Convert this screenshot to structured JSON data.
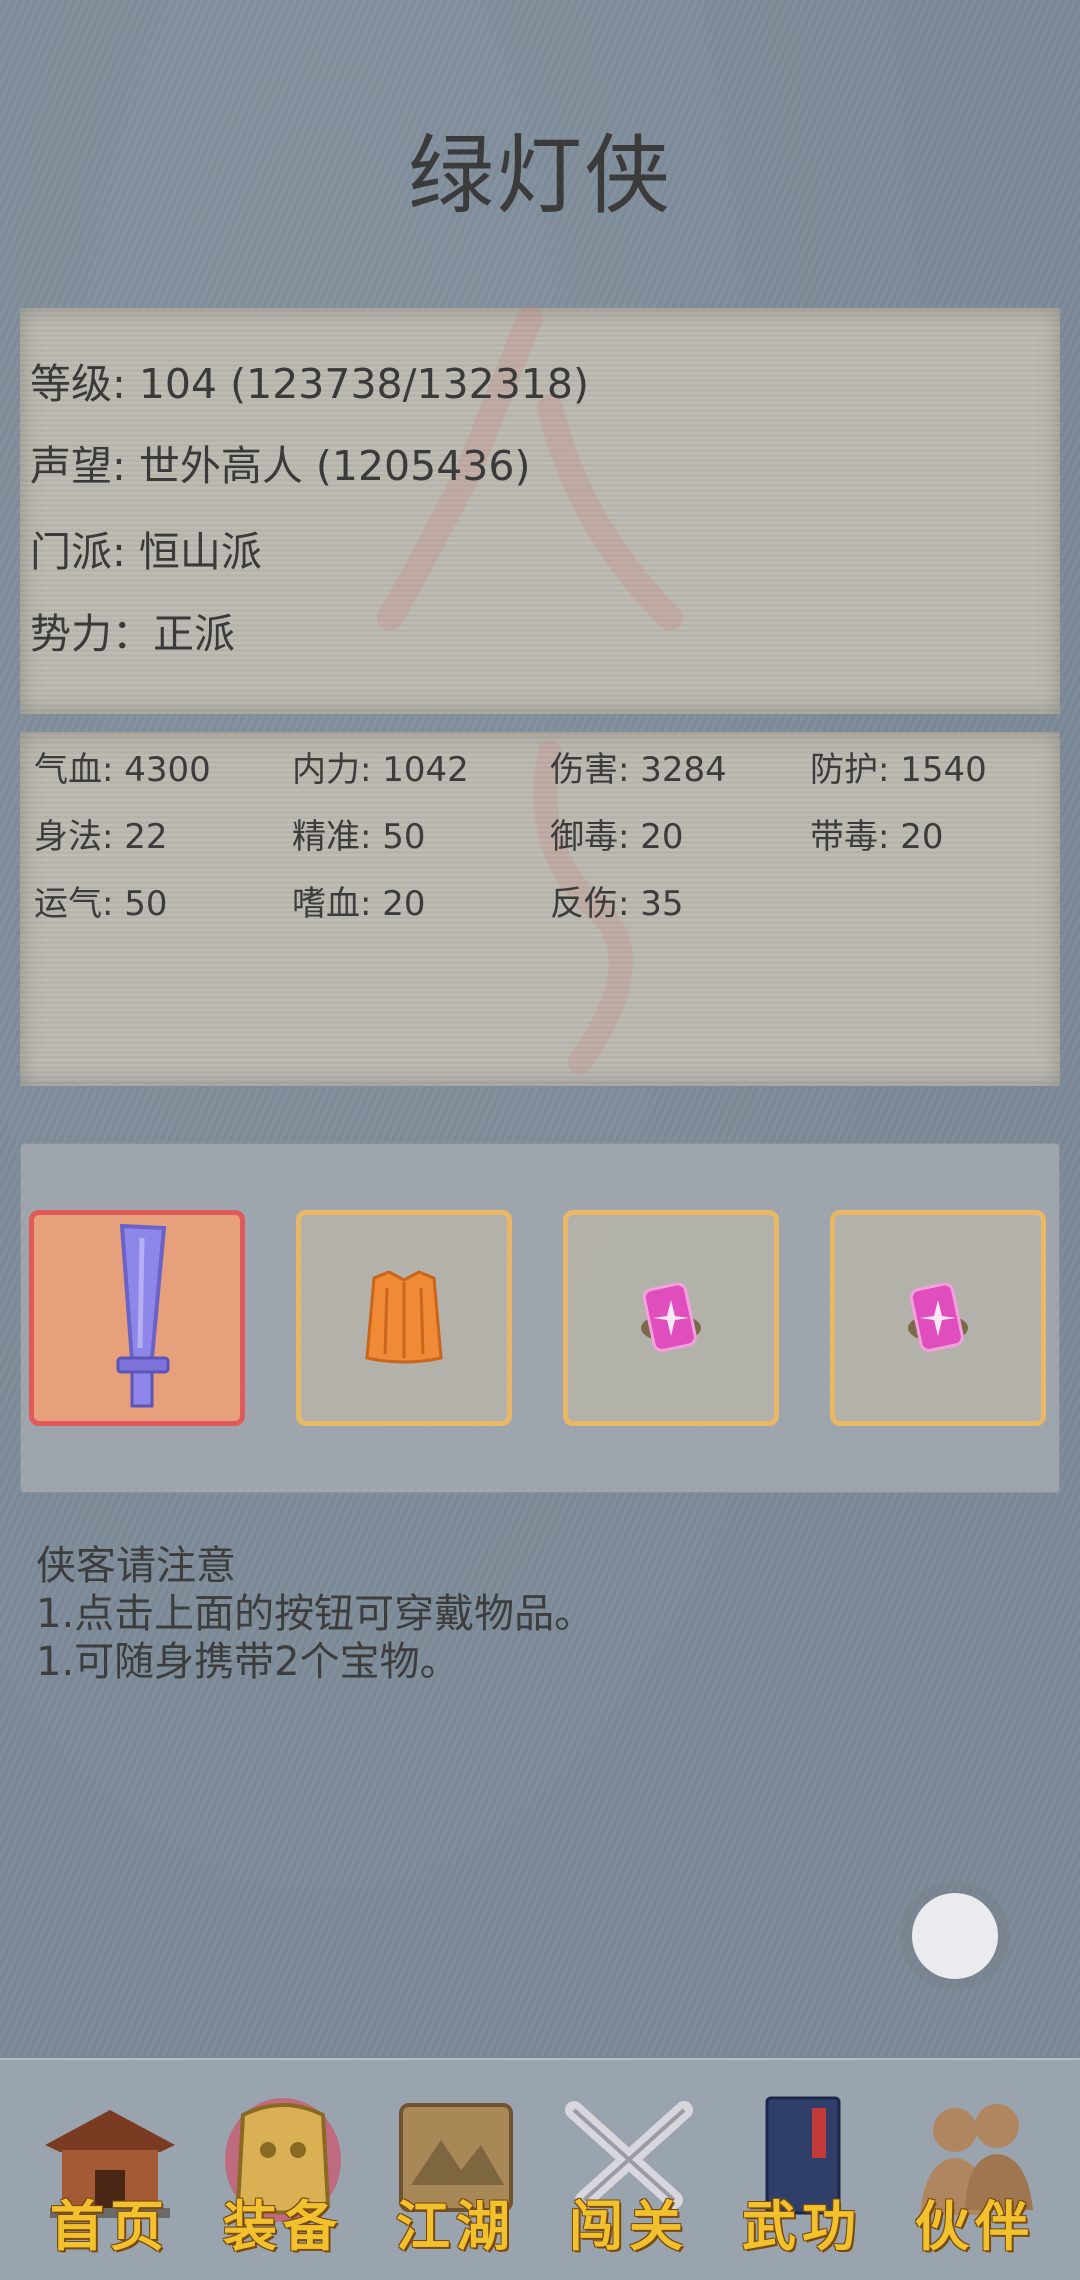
{
  "title": "绿灯侠",
  "info": {
    "level": "等级: 104 (123738/132318)",
    "reputation": "声望: 世外高人 (1205436)",
    "sect": "门派: 恒山派",
    "faction": "势力：正派"
  },
  "stats": [
    "气血: 4300",
    "内力: 1042",
    "伤害: 3284",
    "防护: 1540",
    "身法: 22",
    "精准: 50",
    "御毒: 20",
    "带毒: 20",
    "运气: 50",
    "嗜血: 20",
    "反伤: 35"
  ],
  "equipment": [
    {
      "icon": "sword-icon",
      "selected": true
    },
    {
      "icon": "robe-icon",
      "selected": false
    },
    {
      "icon": "talisman-icon",
      "selected": false
    },
    {
      "icon": "talisman-icon",
      "selected": false
    }
  ],
  "notice": {
    "title": "侠客请注意",
    "line1": "1.点击上面的按钮可穿戴物品。",
    "line2": "1.可随身携带2个宝物。"
  },
  "nav": [
    {
      "label": "首页",
      "icon": "temple-icon"
    },
    {
      "label": "装备",
      "icon": "armor-icon"
    },
    {
      "label": "江湖",
      "icon": "scroll-icon"
    },
    {
      "label": "闯关",
      "icon": "crossed-swords-icon"
    },
    {
      "label": "武功",
      "icon": "book-icon"
    },
    {
      "label": "伙伴",
      "icon": "companions-icon"
    }
  ],
  "colors": {
    "background": "#7d8b99",
    "paper": "#bcbab1",
    "slot_border": "#e8b867",
    "slot_selected_border": "#e05a5a",
    "nav_label": "#f2c12e"
  }
}
